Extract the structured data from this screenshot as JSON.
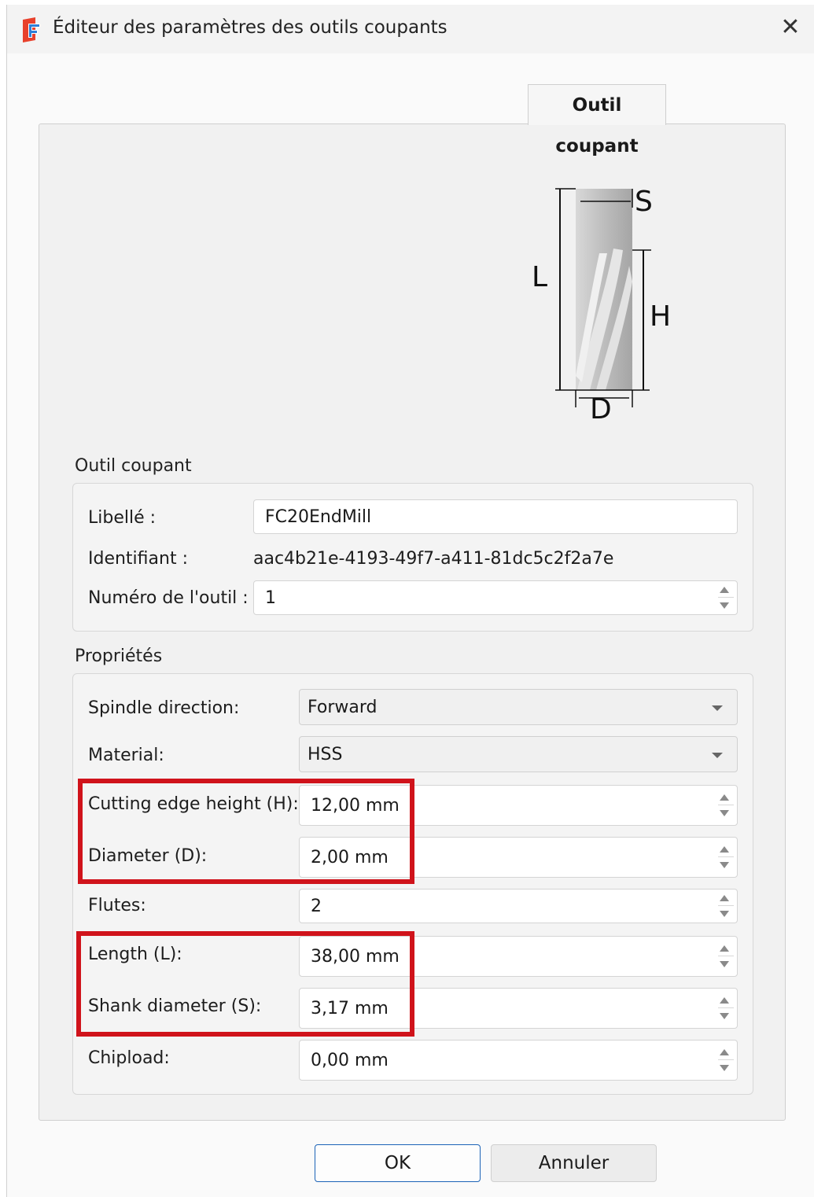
{
  "window": {
    "title": "Éditeur des paramètres des outils coupants",
    "close_glyph": "✕"
  },
  "tab": {
    "label": "Outil coupant"
  },
  "diagram": {
    "labels": {
      "S": "S",
      "L": "L",
      "H": "H",
      "D": "D"
    }
  },
  "tool_group": {
    "title": "Outil coupant",
    "label_name": "Libellé :",
    "name_value": "FC20EndMill",
    "label_id": "Identifiant :",
    "id_value": "aac4b21e-4193-49f7-a411-81dc5c2f2a7e",
    "label_number": "Numéro de l'outil :",
    "number_value": "1"
  },
  "properties": {
    "title": "Propriétés",
    "spindle_label": "Spindle direction:",
    "spindle_value": "Forward",
    "material_label": "Material:",
    "material_value": "HSS",
    "cut_height_label": "Cutting edge height (H):",
    "cut_height_value": "12,00 mm",
    "diameter_label": "Diameter (D):",
    "diameter_value": "2,00 mm",
    "flutes_label": "Flutes:",
    "flutes_value": "2",
    "length_label": "Length (L):",
    "length_value": "38,00 mm",
    "shank_label": "Shank diameter (S):",
    "shank_value": "3,17 mm",
    "chipload_label": "Chipload:",
    "chipload_value": "0,00 mm"
  },
  "buttons": {
    "ok": "OK",
    "cancel": "Annuler"
  },
  "colors": {
    "highlight": "#d0131b",
    "ok_border": "#1c63b7",
    "app_icon": "#e8412c"
  }
}
